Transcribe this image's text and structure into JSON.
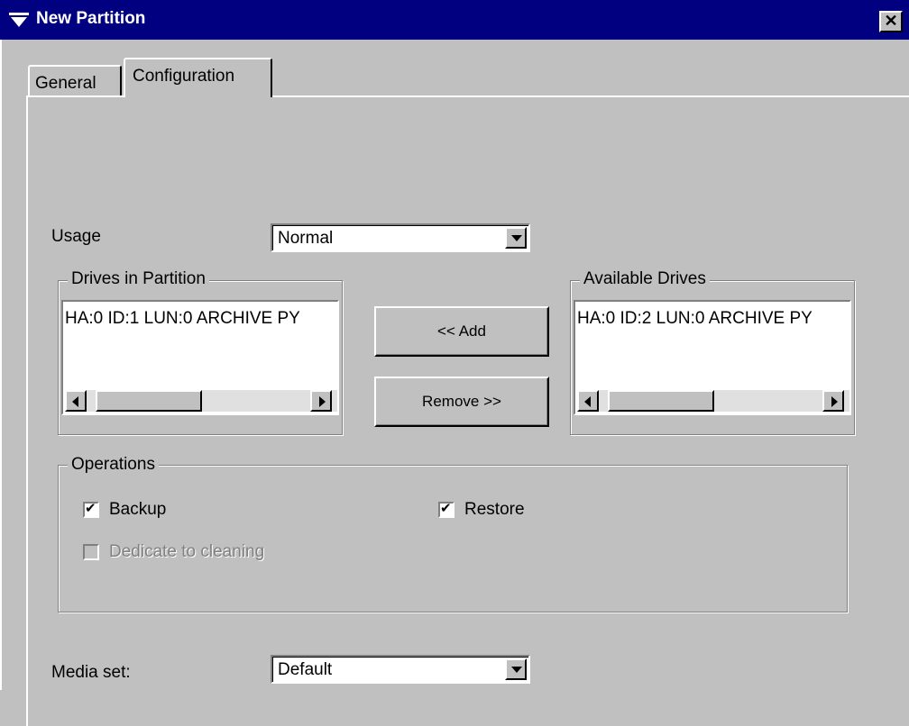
{
  "window": {
    "title": "New Partition",
    "close_label": "✕"
  },
  "tabs": [
    {
      "label": "General",
      "active": false
    },
    {
      "label": "Configuration",
      "active": true
    }
  ],
  "usage": {
    "label": "Usage",
    "value": "Normal"
  },
  "drives_in_partition": {
    "title": "Drives in Partition",
    "items": [
      "HA:0 ID:1 LUN:0 ARCHIVE PY"
    ]
  },
  "available_drives": {
    "title": "Available Drives",
    "items": [
      "HA:0 ID:2 LUN:0 ARCHIVE PY"
    ]
  },
  "buttons": {
    "add": "<< Add",
    "remove": "Remove >>"
  },
  "operations": {
    "title": "Operations",
    "backup": {
      "label": "Backup",
      "checked": true
    },
    "restore": {
      "label": "Restore",
      "checked": true
    },
    "dedicate_cleaning": {
      "label": "Dedicate to cleaning",
      "checked": false,
      "enabled": false
    }
  },
  "media_set": {
    "label": "Media set:",
    "value": "Default"
  },
  "colors": {
    "titlebar": "#000080",
    "face": "#c0c0c0"
  }
}
